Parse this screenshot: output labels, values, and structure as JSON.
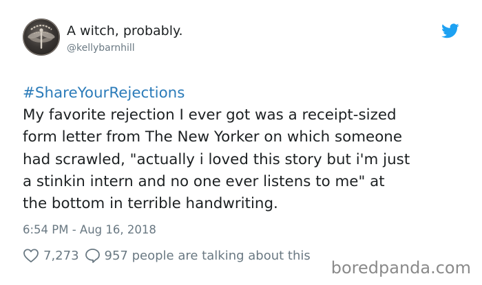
{
  "tweet": {
    "author": {
      "display_name": "A witch, probably.",
      "handle": "@kellybarnhill",
      "avatar_icon": "avatar-dragonfly-logo"
    },
    "brand_icon": "twitter-bird-icon",
    "hashtag": "#ShareYourRejections",
    "body_lines": [
      "My favorite rejection I ever got was a receipt-sized",
      "form letter from The New Yorker on which someone",
      "had scrawled, \"actually i loved this story but i'm just",
      "a stinkin intern and no one ever listens to me\" at",
      "the bottom in terrible handwriting."
    ],
    "timestamp": "6:54 PM - Aug 16, 2018",
    "likes_count": "7,273",
    "replies_text": "957 people are talking about this"
  },
  "watermark": "boredpanda.com",
  "colors": {
    "link": "#2b7bb9",
    "twitter_blue": "#1da1f2",
    "muted": "#697882",
    "text": "#1c2022"
  }
}
